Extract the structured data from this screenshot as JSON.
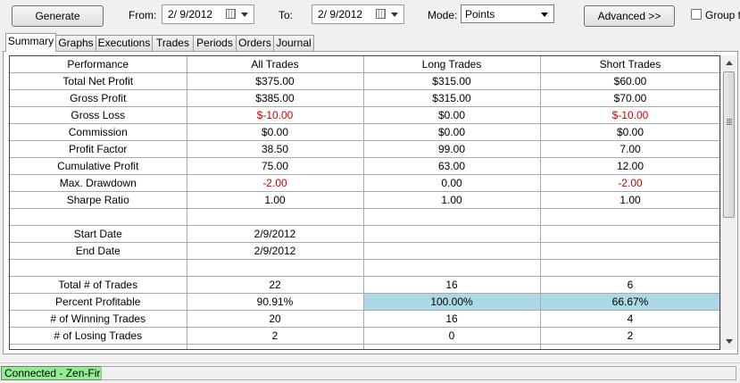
{
  "toolbar": {
    "generate_label": "Generate",
    "from_label": "From:",
    "from_value": "2/  9/2012",
    "to_label": "To:",
    "to_value": "2/  9/2012",
    "mode_label": "Mode:",
    "mode_value": "Points",
    "advanced_label": "Advanced >>",
    "group_label": "Group t"
  },
  "tabs": [
    "Summary",
    "Graphs",
    "Executions",
    "Trades",
    "Periods",
    "Orders",
    "Journal"
  ],
  "active_tab": "Summary",
  "table": {
    "headers": [
      "Performance",
      "All Trades",
      "Long Trades",
      "Short Trades"
    ],
    "rows": [
      [
        "Total Net Profit",
        "$375.00",
        "$315.00",
        "$60.00"
      ],
      [
        "Gross Profit",
        "$385.00",
        "$315.00",
        "$70.00"
      ],
      [
        "Gross Loss",
        "$-10.00",
        "$0.00",
        "$-10.00"
      ],
      [
        "Commission",
        "$0.00",
        "$0.00",
        "$0.00"
      ],
      [
        "Profit Factor",
        "38.50",
        "99.00",
        "7.00"
      ],
      [
        "Cumulative Profit",
        "75.00",
        "63.00",
        "12.00"
      ],
      [
        "Max. Drawdown",
        "-2.00",
        "0.00",
        "-2.00"
      ],
      [
        "Sharpe Ratio",
        "1.00",
        "1.00",
        "1.00"
      ],
      [
        "",
        "",
        "",
        ""
      ],
      [
        "Start Date",
        "2/9/2012",
        "",
        ""
      ],
      [
        "End Date",
        "2/9/2012",
        "",
        ""
      ],
      [
        "",
        "",
        "",
        ""
      ],
      [
        "Total # of Trades",
        "22",
        "16",
        "6"
      ],
      [
        "Percent Profitable",
        "90.91%",
        "100.00%",
        "66.67%"
      ],
      [
        "# of Winning Trades",
        "20",
        "16",
        "4"
      ],
      [
        "# of Losing Trades",
        "2",
        "0",
        "2"
      ],
      [
        "",
        "",
        "",
        ""
      ]
    ],
    "negative_color": "#d00000",
    "highlight_color": "#add8e6",
    "highlight_row": 13,
    "highlight_cols": [
      2,
      3
    ]
  },
  "status": {
    "connection": "Connected - Zen-Fire",
    "connection_color": "#90ee90"
  }
}
